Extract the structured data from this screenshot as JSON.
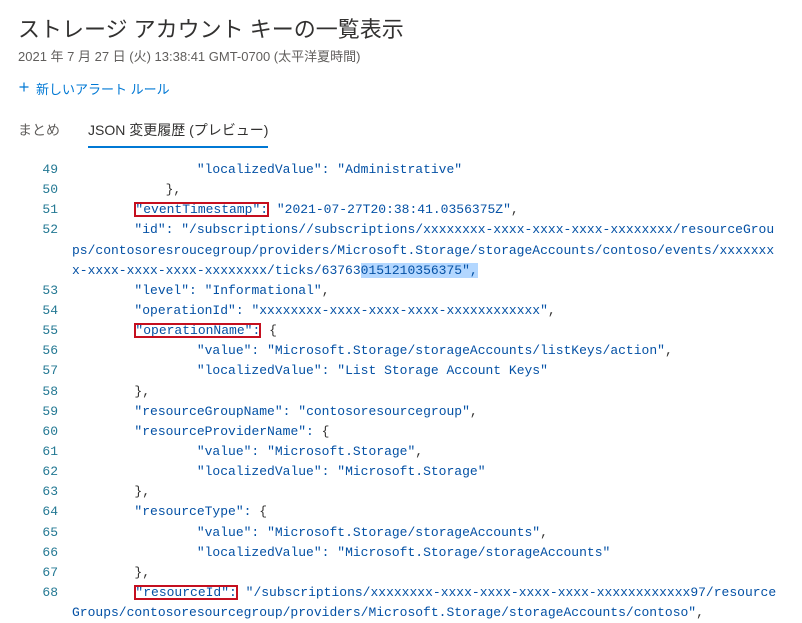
{
  "header": {
    "title": "ストレージ アカウント キーの一覧表示",
    "subtitle": "2021 年 7 月 27 日 (火) 13:38:41 GMT-0700 (太平洋夏時間)",
    "new_alert": "新しいアラート ルール"
  },
  "tabs": {
    "summary": "まとめ",
    "json_history": "JSON 変更履歴 (プレビュー)"
  },
  "code": {
    "49": {
      "indent": 16,
      "key": "localizedValue",
      "val": "Administrative"
    },
    "50": {
      "indent": 12,
      "close": "},"
    },
    "51": {
      "indent": 8,
      "key": "eventTimestamp",
      "hl_key": true,
      "val": "2021-07-27T20:38:41.0356375Z",
      "trail": ","
    },
    "52": {
      "indent": 8,
      "key": "id",
      "val_pre": "/subscriptions//subscriptions/xxxxxxxx-xxxx-xxxx-xxxx-xxxxxxxx/resourceGroups/contosoresroucegroup/providers/Microsoft.Storage/storageAccounts/contoso/events/xxxxxxxx-xxxx-xxxx-xxxx-xxxxxxxx/ticks/63763",
      "val_sel": "0151210356375\",",
      "trail": ""
    },
    "53": {
      "indent": 8,
      "key": "level",
      "val": "Informational",
      "trail": ","
    },
    "54": {
      "indent": 8,
      "key": "operationId",
      "val": "xxxxxxxx-xxxx-xxxx-xxxx-xxxxxxxxxxxx",
      "trail": ","
    },
    "55": {
      "indent": 8,
      "key": "operationName",
      "hl_key": true,
      "open": "{"
    },
    "56": {
      "indent": 16,
      "key": "value",
      "val": "Microsoft.Storage/storageAccounts/listKeys/action",
      "trail": ","
    },
    "57": {
      "indent": 16,
      "key": "localizedValue",
      "val": "List Storage Account Keys"
    },
    "58": {
      "indent": 8,
      "close": "},"
    },
    "59": {
      "indent": 8,
      "key": "resourceGroupName",
      "val": "contosoresourcegroup",
      "trail": ","
    },
    "60": {
      "indent": 8,
      "key": "resourceProviderName",
      "open": "{"
    },
    "61": {
      "indent": 16,
      "key": "value",
      "val": "Microsoft.Storage",
      "trail": ","
    },
    "62": {
      "indent": 16,
      "key": "localizedValue",
      "val": "Microsoft.Storage"
    },
    "63": {
      "indent": 8,
      "close": "},"
    },
    "64": {
      "indent": 8,
      "key": "resourceType",
      "open": "{"
    },
    "65": {
      "indent": 16,
      "key": "value",
      "val": "Microsoft.Storage/storageAccounts",
      "trail": ","
    },
    "66": {
      "indent": 16,
      "key": "localizedValue",
      "val": "Microsoft.Storage/storageAccounts"
    },
    "67": {
      "indent": 8,
      "close": "},"
    },
    "68": {
      "indent": 8,
      "key": "resourceId",
      "hl_key": true,
      "val": "/subscriptions/xxxxxxxx-xxxx-xxxx-xxxx-xxxx-xxxxxxxxxxxx97/resourceGroups/contosoresourcegroup/providers/Microsoft.Storage/storageAccounts/contoso",
      "trail": ","
    }
  }
}
